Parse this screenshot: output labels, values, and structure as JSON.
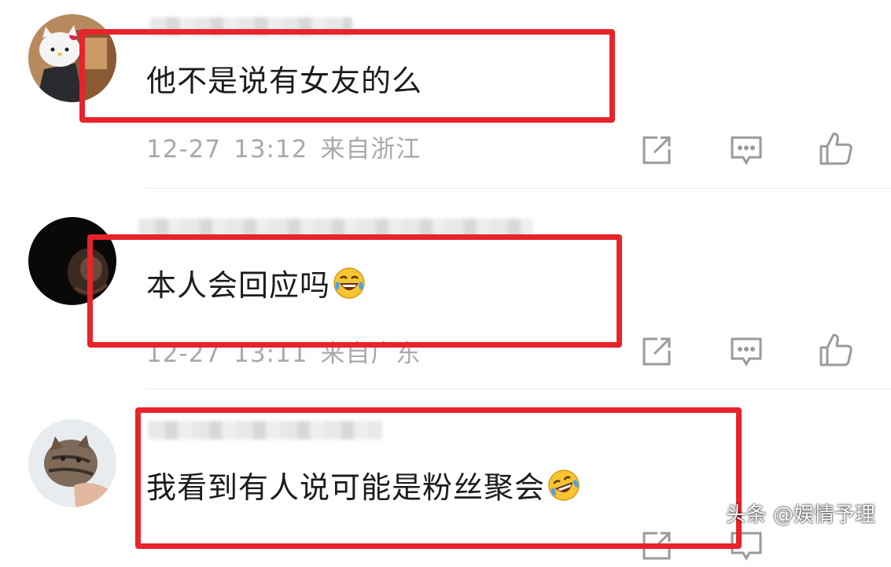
{
  "comments": [
    {
      "text": "他不是说有女友的么",
      "date": "12-27",
      "time": "13:12",
      "location": "来自浙江"
    },
    {
      "text": "本人会回应吗",
      "date": "12-27",
      "time": "13:11",
      "location": "来自广东"
    },
    {
      "text": "我看到有人说可能是粉丝聚会"
    }
  ],
  "watermark": "头条 @娱情予理",
  "colors": {
    "highlight": "#e8232a",
    "meta_text": "#a9a9a9",
    "icon": "#9a9a9a"
  },
  "icons": [
    "share-icon",
    "comment-icon",
    "like-icon",
    "laughing-tears-emoji",
    "rolling-laughing-emoji"
  ]
}
